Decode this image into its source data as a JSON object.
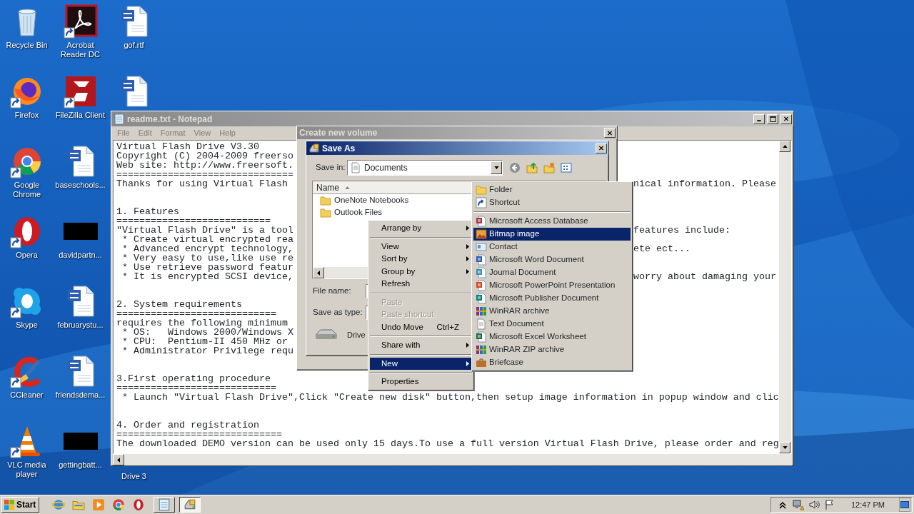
{
  "desktop": {
    "columns": [
      [
        {
          "label": "Recycle Bin",
          "kind": "recycle",
          "shortcut": false
        },
        {
          "label": "Firefox",
          "kind": "firefox",
          "shortcut": true
        },
        {
          "label": "Google Chrome",
          "kind": "chrome",
          "shortcut": true
        },
        {
          "label": "Opera",
          "kind": "opera",
          "shortcut": true
        },
        {
          "label": "Skype",
          "kind": "skype",
          "shortcut": true
        },
        {
          "label": "CCleaner",
          "kind": "ccleaner",
          "shortcut": true
        },
        {
          "label": "VLC media player",
          "kind": "vlc",
          "shortcut": true
        }
      ],
      [
        {
          "label": "Acrobat Reader DC",
          "kind": "acrobat",
          "shortcut": true
        },
        {
          "label": "FileZilla Client",
          "kind": "filezilla",
          "shortcut": true
        },
        {
          "label": "baseschools...",
          "kind": "word",
          "shortcut": false
        },
        {
          "label": "davidpartn...",
          "kind": "thumb",
          "shortcut": false
        },
        {
          "label": "februarystu...",
          "kind": "word",
          "shortcut": false
        },
        {
          "label": "friendsdema...",
          "kind": "word",
          "shortcut": false
        },
        {
          "label": "gettingbatt...",
          "kind": "thumb",
          "shortcut": false
        }
      ],
      [
        {
          "label": "gof.rtf",
          "kind": "word",
          "shortcut": false
        },
        {
          "kind": "word",
          "shortcut": false
        },
        {
          "label": "Drive 3",
          "kind": "hidden"
        }
      ]
    ]
  },
  "notepad": {
    "title": "readme.txt - Notepad",
    "menu": [
      "File",
      "Edit",
      "Format",
      "View",
      "Help"
    ],
    "lines": [
      {
        "kind": "text",
        "text": "Virtual Flash Drive V3.30"
      },
      {
        "kind": "text",
        "text": "Copyright (C) 2004-2009 freerso"
      },
      {
        "kind": "text",
        "text": "Web site: http://www.freersoft."
      },
      {
        "kind": "text",
        "text": "==============================="
      },
      {
        "kind": "text",
        "text": "Thanks for using Virtual Flash",
        "tail": "nical information. Please"
      },
      {
        "kind": "blank"
      },
      {
        "kind": "blank"
      },
      {
        "kind": "text",
        "text": "1. Features"
      },
      {
        "kind": "text",
        "text": "==========================="
      },
      {
        "kind": "text",
        "text": "\"Virtual Flash Drive\" is a tool",
        "tail": "features include:"
      },
      {
        "kind": "text",
        "text": " * Create virtual encrypted rea"
      },
      {
        "kind": "text",
        "text": " * Advanced encrypt technology,",
        "tail": "ete ect..."
      },
      {
        "kind": "text",
        "text": " * Very easy to use,like use re"
      },
      {
        "kind": "text",
        "text": " * Use retrieve password featur"
      },
      {
        "kind": "text",
        "text": " * It is encrypted SCSI device,",
        "tail": "worry about damaging your"
      },
      {
        "kind": "blank"
      },
      {
        "kind": "blank"
      },
      {
        "kind": "text",
        "text": "2. System requirements"
      },
      {
        "kind": "text",
        "text": "============================"
      },
      {
        "kind": "text",
        "text": "requires the following minimum"
      },
      {
        "kind": "text",
        "text": " * OS:   Windows 2000/Windows X"
      },
      {
        "kind": "text",
        "text": " * CPU:  Pentium-II 450 MHz or"
      },
      {
        "kind": "text",
        "text": " * Administrator Privilege requ"
      },
      {
        "kind": "blank"
      },
      {
        "kind": "blank"
      },
      {
        "kind": "text",
        "text": "3.First operating procedure"
      },
      {
        "kind": "text",
        "text": "============================"
      },
      {
        "kind": "text",
        "text": " * Launch \"Virtual Flash Drive\",Click \"Create new disk\" button,then setup image information in popup window and clic"
      },
      {
        "kind": "blank"
      },
      {
        "kind": "blank"
      },
      {
        "kind": "text",
        "text": "4. Order and registration"
      },
      {
        "kind": "text",
        "text": "============================="
      },
      {
        "kind": "text",
        "text": "The downloaded DEMO version can be used only 15 days.To use a full version Virtual Flash Drive, please order and reg"
      }
    ]
  },
  "volume_dialog": {
    "title": "Create new volume"
  },
  "save_as": {
    "title": "Save As",
    "save_in_label": "Save in:",
    "save_in_value": "Documents",
    "list_header": "Name",
    "files": [
      "OneNote Notebooks",
      "Outlook Files"
    ],
    "file_name_label": "File name:",
    "save_as_type_label": "Save as type:",
    "drive_label": "Drive"
  },
  "context_menu": [
    {
      "kind": "item",
      "label": "Arrange by",
      "submenu": true,
      "disabled": false,
      "selected": false
    },
    {
      "kind": "separator"
    },
    {
      "kind": "item",
      "label": "View",
      "submenu": true,
      "disabled": false,
      "selected": false
    },
    {
      "kind": "item",
      "label": "Sort by",
      "submenu": true,
      "disabled": false,
      "selected": false
    },
    {
      "kind": "item",
      "label": "Group by",
      "submenu": true,
      "disabled": false,
      "selected": false
    },
    {
      "kind": "item",
      "label": "Refresh",
      "submenu": false,
      "disabled": false,
      "selected": false
    },
    {
      "kind": "separator"
    },
    {
      "kind": "item",
      "label": "Paste",
      "submenu": false,
      "disabled": true,
      "selected": false
    },
    {
      "kind": "item",
      "label": "Paste shortcut",
      "submenu": false,
      "disabled": true,
      "selected": false
    },
    {
      "kind": "item",
      "label": "Undo Move",
      "shortcut": "Ctrl+Z",
      "submenu": false,
      "disabled": false,
      "selected": false
    },
    {
      "kind": "separator"
    },
    {
      "kind": "item",
      "label": "Share with",
      "submenu": true,
      "disabled": false,
      "selected": false
    },
    {
      "kind": "separator"
    },
    {
      "kind": "item",
      "label": "New",
      "submenu": true,
      "disabled": false,
      "selected": true
    },
    {
      "kind": "separator"
    },
    {
      "kind": "item",
      "label": "Properties",
      "submenu": false,
      "disabled": false,
      "selected": false
    }
  ],
  "new_submenu": [
    {
      "kind": "folder",
      "label": "Folder",
      "selected": false
    },
    {
      "kind": "shortcut",
      "label": "Shortcut",
      "selected": false
    },
    {
      "kind": "separator"
    },
    {
      "kind": "access",
      "label": "Microsoft Access Database",
      "selected": false
    },
    {
      "kind": "bitmap",
      "label": "Bitmap image",
      "selected": true
    },
    {
      "kind": "contact",
      "label": "Contact",
      "selected": false
    },
    {
      "kind": "word",
      "label": "Microsoft Word Document",
      "selected": false
    },
    {
      "kind": "journal",
      "label": "Journal Document",
      "selected": false
    },
    {
      "kind": "powerpoint",
      "label": "Microsoft PowerPoint Presentation",
      "selected": false
    },
    {
      "kind": "publisher",
      "label": "Microsoft Publisher Document",
      "selected": false
    },
    {
      "kind": "winrar",
      "label": "WinRAR archive",
      "selected": false
    },
    {
      "kind": "text",
      "label": "Text Document",
      "selected": false
    },
    {
      "kind": "excel",
      "label": "Microsoft Excel Worksheet",
      "selected": false
    },
    {
      "kind": "winrar",
      "label": "WinRAR ZIP archive",
      "selected": false
    },
    {
      "kind": "briefcase",
      "label": "Briefcase",
      "selected": false
    }
  ],
  "taskbar": {
    "start_label": "Start",
    "quick_launch": [
      {
        "kind": "ie"
      },
      {
        "kind": "explorer"
      },
      {
        "kind": "media"
      },
      {
        "kind": "chrome"
      },
      {
        "kind": "opera"
      }
    ],
    "tasks": [
      {
        "kind": "notepad",
        "selected": false
      },
      {
        "kind": "drive",
        "selected": true
      }
    ],
    "tray": [
      {
        "kind": "chevron"
      },
      {
        "kind": "network"
      },
      {
        "kind": "speaker"
      },
      {
        "kind": "flag"
      }
    ],
    "clock": "12:47 PM"
  }
}
